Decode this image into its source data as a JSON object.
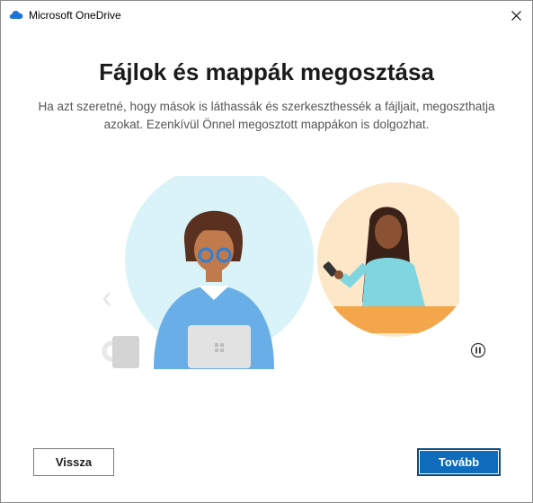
{
  "window": {
    "title": "Microsoft OneDrive"
  },
  "main": {
    "heading": "Fájlok és mappák megosztása",
    "description": "Ha azt szeretné, hogy mások is láthassák és szerkeszthessék a fájljait, megoszthatja azokat. Ezenkívül Önnel megosztott mappákon is dolgozhat."
  },
  "buttons": {
    "back_label": "Vissza",
    "next_label": "Tovább"
  },
  "icons": {
    "app": "onedrive-cloud-icon",
    "close": "close-icon",
    "pause": "pause-icon",
    "previous": "chevron-left-icon"
  },
  "colors": {
    "accent": "#0f6cbd",
    "circle_left": "#d9f3f8",
    "circle_right": "#fde7c9"
  }
}
